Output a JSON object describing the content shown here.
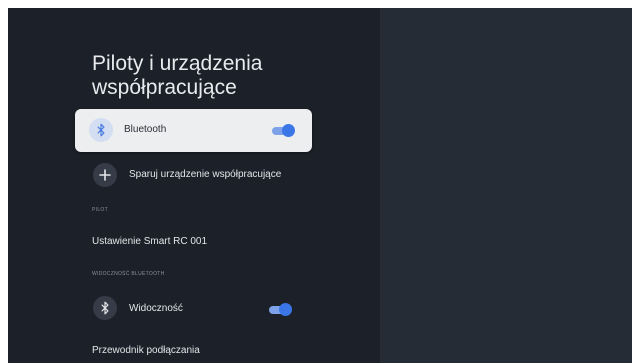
{
  "page": {
    "title": "Piloty i urządzenia współpracujące"
  },
  "items": {
    "bluetooth": {
      "label": "Bluetooth",
      "icon": "bluetooth-icon",
      "toggle_on": true
    },
    "pair": {
      "label": "Sparuj urządzenie współpracujące",
      "icon": "plus-icon"
    },
    "remote_section": "PILOT",
    "remote_setting": "Ustawienie Smart RC 001",
    "visibility_section": "WIDOCZNOŚĆ BLUETOOTH",
    "visibility": {
      "label": "Widoczność",
      "icon": "bluetooth-icon",
      "toggle_on": true
    },
    "guide": "Przewodnik podłączania"
  },
  "colors": {
    "accent": "#3a76e6",
    "panel": "#1c2028",
    "background": "#262c35"
  }
}
